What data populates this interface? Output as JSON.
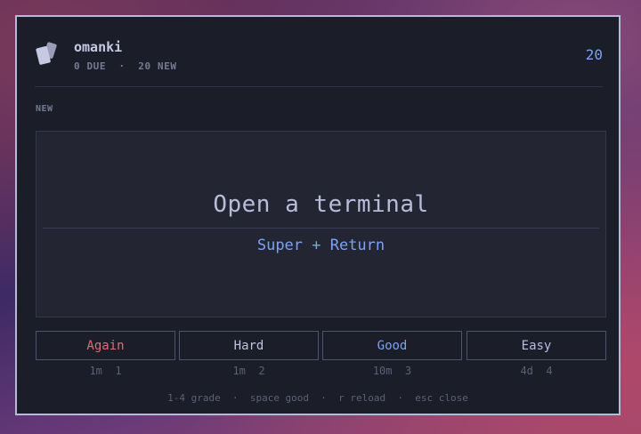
{
  "app": {
    "title": "omanki",
    "subtitle": "0 DUE  ·  20 NEW",
    "count": "20",
    "icon": "cards-icon"
  },
  "card": {
    "state": "NEW",
    "front": "Open a terminal",
    "back": "Super + Return"
  },
  "grades": [
    {
      "label": "Again",
      "meta": "1m  1",
      "color": "#e06c75"
    },
    {
      "label": "Hard",
      "meta": "1m  2",
      "color": "#c0c3dc"
    },
    {
      "label": "Good",
      "meta": "10m  3",
      "color": "#7aa2f7"
    },
    {
      "label": "Easy",
      "meta": "4d  4",
      "color": "#b6bde8"
    }
  ],
  "footer": "1-4 grade  ·  space good  ·  r reload  ·  esc close",
  "colors": {
    "accent": "#7aa2f7",
    "again": "#e06c75",
    "border": "#b7b9d8",
    "background": "#1b1d28"
  }
}
